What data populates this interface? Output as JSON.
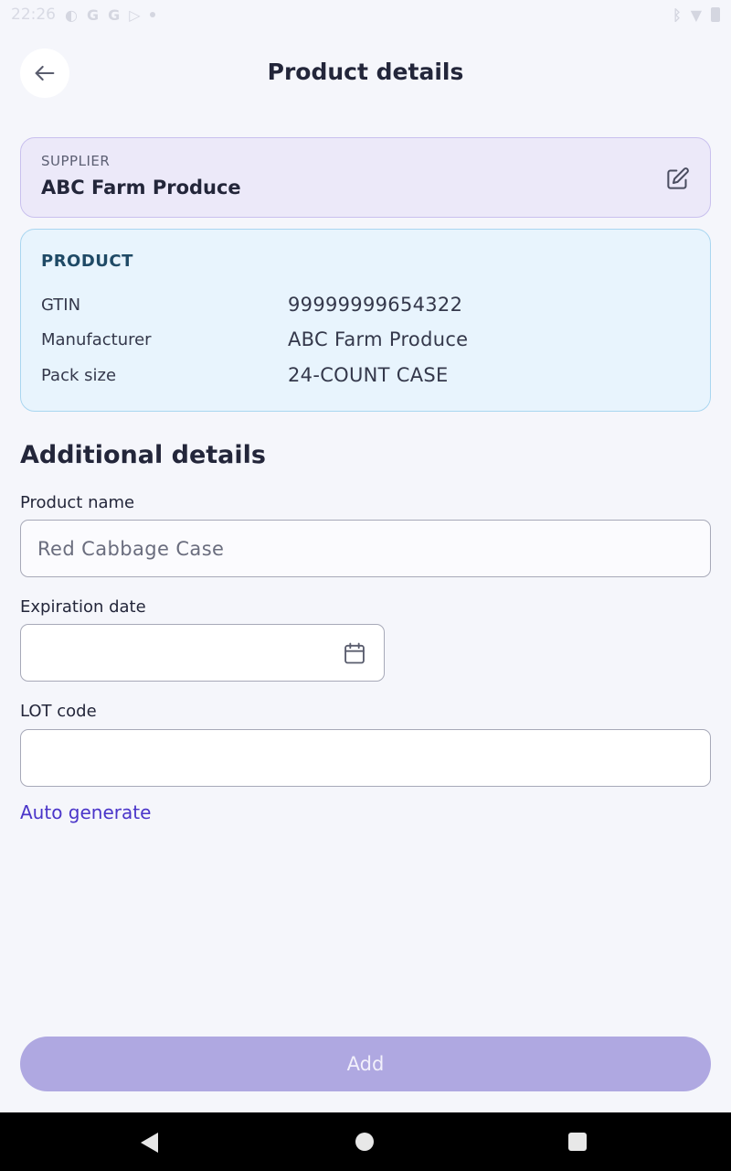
{
  "status_bar": {
    "time": "22:26",
    "left_icons": [
      "data-saver-icon",
      "google-icon",
      "google-icon",
      "play-store-icon",
      "dot-icon"
    ],
    "right_icons": [
      "bluetooth-icon",
      "wifi-icon",
      "battery-icon"
    ]
  },
  "header": {
    "title": "Product details",
    "back_icon": "arrow-left-icon"
  },
  "supplier": {
    "label": "SUPPLIER",
    "name": "ABC Farm Produce",
    "edit_icon": "edit-icon"
  },
  "product": {
    "heading": "PRODUCT",
    "rows": [
      {
        "key": "GTIN",
        "value": "99999999654322"
      },
      {
        "key": "Manufacturer",
        "value": "ABC Farm Produce"
      },
      {
        "key": "Pack size",
        "value": "24-COUNT CASE"
      }
    ]
  },
  "additional": {
    "title": "Additional details",
    "product_name": {
      "label": "Product name",
      "value": "Red Cabbage Case"
    },
    "expiration_date": {
      "label": "Expiration date",
      "value": "",
      "icon": "calendar-icon"
    },
    "lot_code": {
      "label": "LOT code",
      "value": ""
    },
    "auto_generate": "Auto generate"
  },
  "actions": {
    "add_label": "Add"
  },
  "colors": {
    "background": "#f5f6fb",
    "supplier_card": "#ece9f9",
    "product_card": "#e8f4fd",
    "accent": "#4a35c9",
    "add_button_disabled": "#afa8e1"
  }
}
